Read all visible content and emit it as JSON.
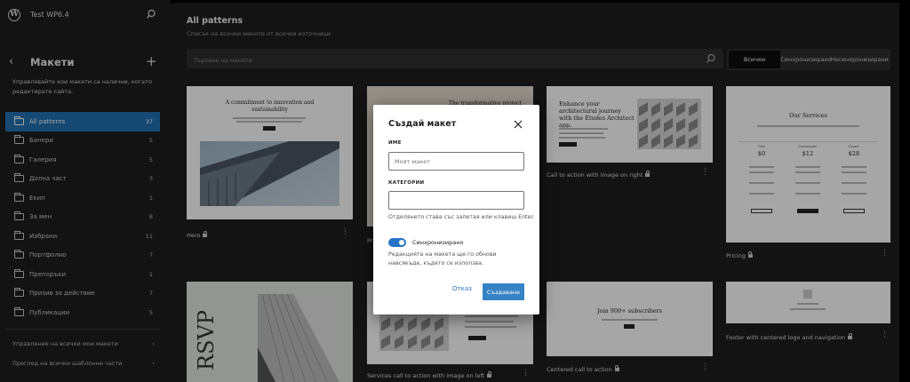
{
  "site": {
    "title": "Test WP6.4"
  },
  "sidebar": {
    "title": "Макети",
    "description": "Управлявайте кои макети са налични, когато редактирате сайта.",
    "categories": [
      {
        "label": "All patterns",
        "count": "37",
        "active": true
      },
      {
        "label": "Банери",
        "count": "5"
      },
      {
        "label": "Галерия",
        "count": "5"
      },
      {
        "label": "Долна част",
        "count": "3"
      },
      {
        "label": "Екип",
        "count": "1"
      },
      {
        "label": "За мен",
        "count": "8"
      },
      {
        "label": "Избрани",
        "count": "11"
      },
      {
        "label": "Портфолио",
        "count": "7"
      },
      {
        "label": "Препоръки",
        "count": "1"
      },
      {
        "label": "Призив за действие",
        "count": "7"
      },
      {
        "label": "Публикации",
        "count": "5"
      }
    ],
    "footer_links": [
      "Управление на всички мои макети",
      "Преглед на всички шаблонни части"
    ]
  },
  "main": {
    "title": "All patterns",
    "subtitle": "Списък на всички макети от всички източници",
    "search_placeholder": "Търсене на макети",
    "filters": [
      "Всички",
      "Синхронизирано",
      "Несинхронизирани"
    ]
  },
  "cards": {
    "hero": {
      "title": "Hero",
      "heading": "A commitment to innovation and sustainability"
    },
    "card2": {
      "title": "Pr",
      "heading": "The transformative project seeks to"
    },
    "cta_right": {
      "title": "Call to action with image on right",
      "heading": "Enhance your architectural journey with the Études Architect app."
    },
    "pricing": {
      "title": "Pricing",
      "heading": "Our Services",
      "prices": [
        "$0",
        "$12",
        "$28"
      ],
      "tiers": [
        "Free",
        "Connoisseur",
        "Expert"
      ]
    },
    "rsvp": {
      "title": "",
      "heading": "RSVP"
    },
    "services_left": {
      "title": "Services call to action with image on left"
    },
    "centered_cta": {
      "title": "Centered call to action",
      "heading": "Join 900+ subscribers"
    },
    "footer_logo": {
      "title": "Footer with centered logo and navigation"
    }
  },
  "modal": {
    "title": "Създай макет",
    "name_label": "Име",
    "name_placeholder": "Моят макет",
    "categories_label": "Категории",
    "categories_help": "Отделянето става със запетая или клавиш Enter.",
    "sync_label": "Синхронизирано",
    "sync_on": true,
    "sync_help": "Редакцията на макета ще го обнови навсякъде, където се използва.",
    "cancel_label": "Отказ",
    "create_label": "Създаване"
  },
  "colors": {
    "accent": "#3582c4",
    "sidebar_bg": "#1e1e1e",
    "active_item": "#2271b1"
  }
}
